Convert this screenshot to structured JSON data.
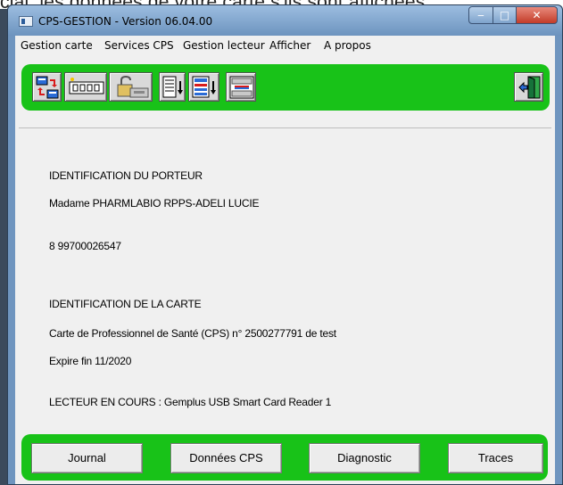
{
  "background_caption": "cial, les données de votre carte s'ils sont affichées",
  "window": {
    "title": "CPS-GESTION - Version 06.04.00",
    "buttons": {
      "minimize": "‒",
      "maximize": "□",
      "close": "✕"
    }
  },
  "menu": [
    {
      "label": "Gestion carte"
    },
    {
      "label": "Services CPS"
    },
    {
      "label": "Gestion lecteur"
    },
    {
      "label": "Afficher"
    },
    {
      "label": "A propos"
    }
  ],
  "toolbar": {
    "icons": [
      "card-transfer-icon",
      "card-reader-icon",
      "card-unlock-icon",
      "document-down-icon",
      "document-list-down-icon",
      "network-switch-icon",
      "exit-door-icon"
    ]
  },
  "content": {
    "porteur_heading": "IDENTIFICATION DU PORTEUR",
    "porteur_name": "Madame PHARMLABIO RPPS-ADELI LUCIE",
    "porteur_id": "8 99700026547",
    "carte_heading": "IDENTIFICATION DE LA CARTE",
    "carte_desc": "Carte de Professionnel de Santé (CPS) n° 2500277791 de test",
    "carte_expiry": "Expire fin 11/2020",
    "lecteur": "LECTEUR EN COURS : Gemplus USB Smart Card Reader 1"
  },
  "bottom_buttons": {
    "journal": "Journal",
    "donnees": "Données CPS",
    "diagnostic": "Diagnostic",
    "traces": "Traces"
  },
  "colors": {
    "toolbar_green": "#18c218",
    "window_frame": "#6f95bf"
  }
}
